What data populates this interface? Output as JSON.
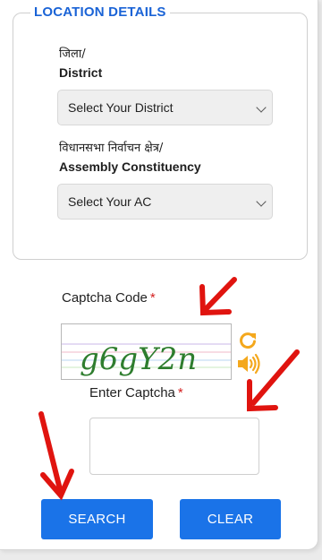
{
  "location_details": {
    "legend": "LOCATION DETAILS",
    "district_label_hi": "जिला/",
    "district_label_en": "District",
    "district_select_value": "Select Your District",
    "ac_label_hi": "विधानसभा निर्वाचन क्षेत्र/",
    "ac_label_en": "Assembly Constituency",
    "ac_select_value": "Select Your AC"
  },
  "captcha": {
    "label": "Captcha Code",
    "required_mark": "*",
    "image_text": "g6gY2n",
    "enter_label": "Enter Captcha",
    "input_value": ""
  },
  "buttons": {
    "search_label": "SEARCH",
    "clear_label": "CLEAR"
  },
  "colors": {
    "accent": "#1a73e8",
    "legend": "#1a63d6",
    "required": "#d42020",
    "icon_orange": "#f4a81d",
    "annotation_arrow": "#e0140f"
  },
  "icons": {
    "refresh": "refresh-icon",
    "audio": "speaker-icon"
  }
}
